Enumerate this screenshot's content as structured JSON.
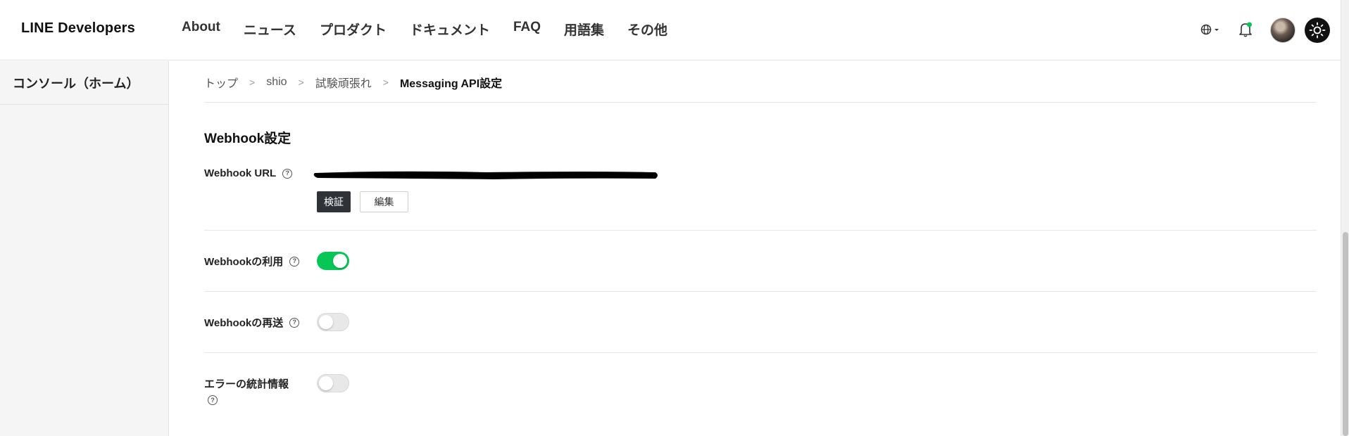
{
  "header": {
    "logo": "LINE Developers",
    "nav": [
      "About",
      "ニュース",
      "プロダクト",
      "ドキュメント",
      "FAQ",
      "用語集",
      "その他"
    ],
    "icons": [
      "globe-icon",
      "bell-icon",
      "avatar",
      "sun-icon"
    ],
    "notification_color": "#06c755"
  },
  "sidebar": {
    "home_label": "コンソール（ホーム）"
  },
  "breadcrumb": {
    "items": [
      "トップ",
      "shio",
      "試験頑張れ"
    ],
    "current": "Messaging API設定",
    "separator": ">"
  },
  "webhook": {
    "section_title": "Webhook設定",
    "url_label": "Webhook URL",
    "help_glyph": "?",
    "verify_button": "検証",
    "edit_button": "編集",
    "use_label": "Webhookの利用",
    "use_enabled": true,
    "resend_label": "Webhookの再送",
    "resend_enabled": false,
    "error_stats_label": "エラーの統計情報",
    "error_stats_enabled": false
  },
  "colors": {
    "accent_green": "#06c755",
    "dark_button": "#2f3338"
  }
}
